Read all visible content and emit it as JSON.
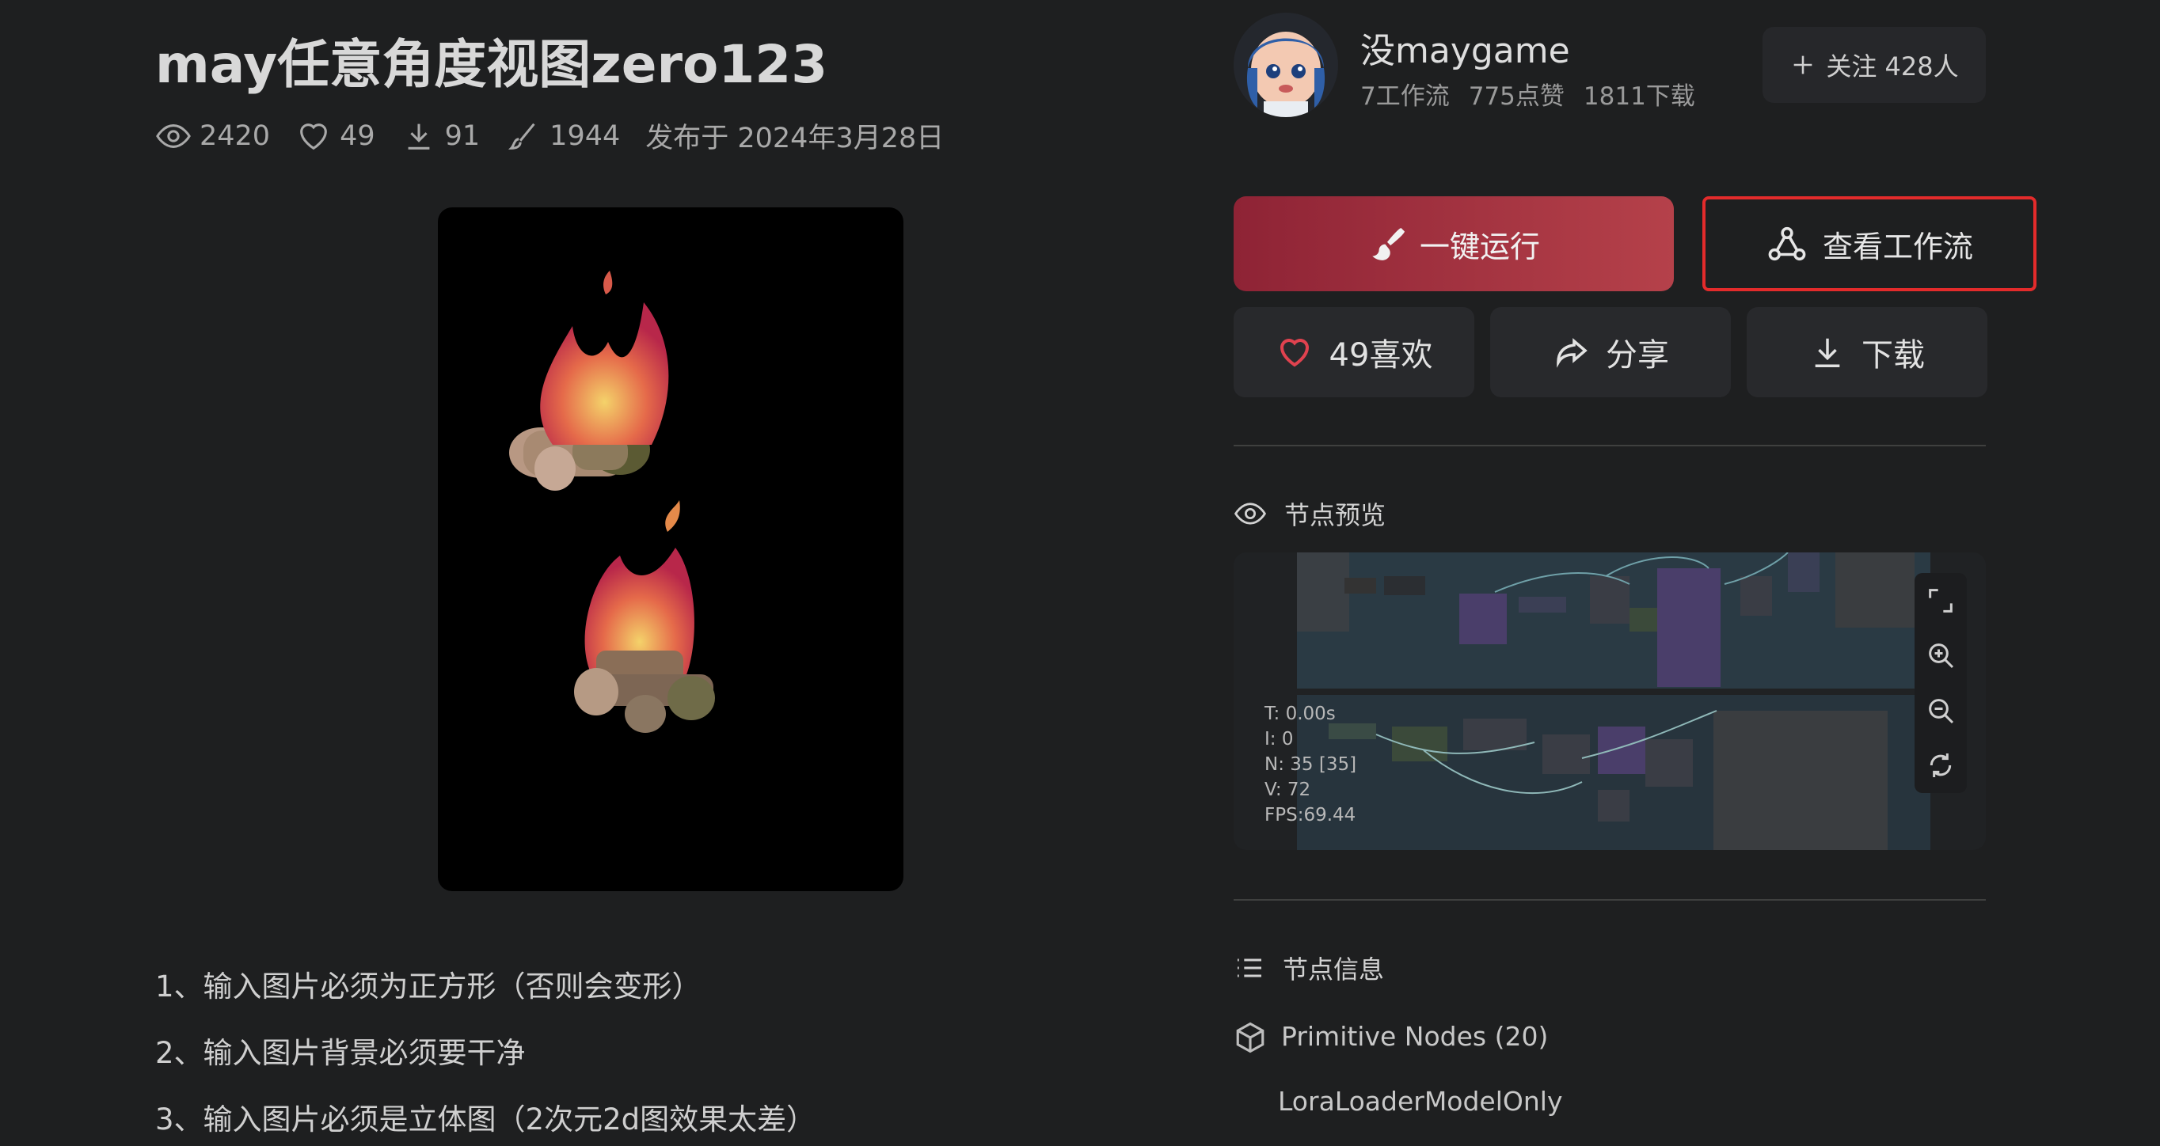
{
  "workflow": {
    "title": "may任意角度视图zero123",
    "stats": {
      "views": "2420",
      "likes": "49",
      "downloads": "91",
      "runs": "1944",
      "published": "发布于 2024年3月28日"
    },
    "description": [
      "1、输入图片必须为正方形（否则会变形）",
      "2、输入图片背景必须要干净",
      "3、输入图片必须是立体图（2次元2d图效果太差）"
    ]
  },
  "author": {
    "name": "没maygame",
    "workflows": "7工作流",
    "likes": "775点赞",
    "downloads": "1811下载",
    "follow_label": "关注 428人"
  },
  "actions": {
    "run_label": "一键运行",
    "view_label": "查看工作流",
    "like_label": "49喜欢",
    "share_label": "分享",
    "download_label": "下载"
  },
  "node_preview": {
    "title": "节点预览",
    "perf": {
      "t": "T: 0.00s",
      "i": "I: 0",
      "n": "N: 35 [35]",
      "v": "V: 72",
      "fps": "FPS:69.44"
    }
  },
  "node_info": {
    "title": "节点信息",
    "group": "Primitive Nodes (20)",
    "first_item": "LoraLoaderModelOnly"
  },
  "colors": {
    "accent_start": "#8e2335",
    "accent_end": "#b5414a",
    "highlight_border": "#e32b2b",
    "background": "#1e1f20"
  }
}
